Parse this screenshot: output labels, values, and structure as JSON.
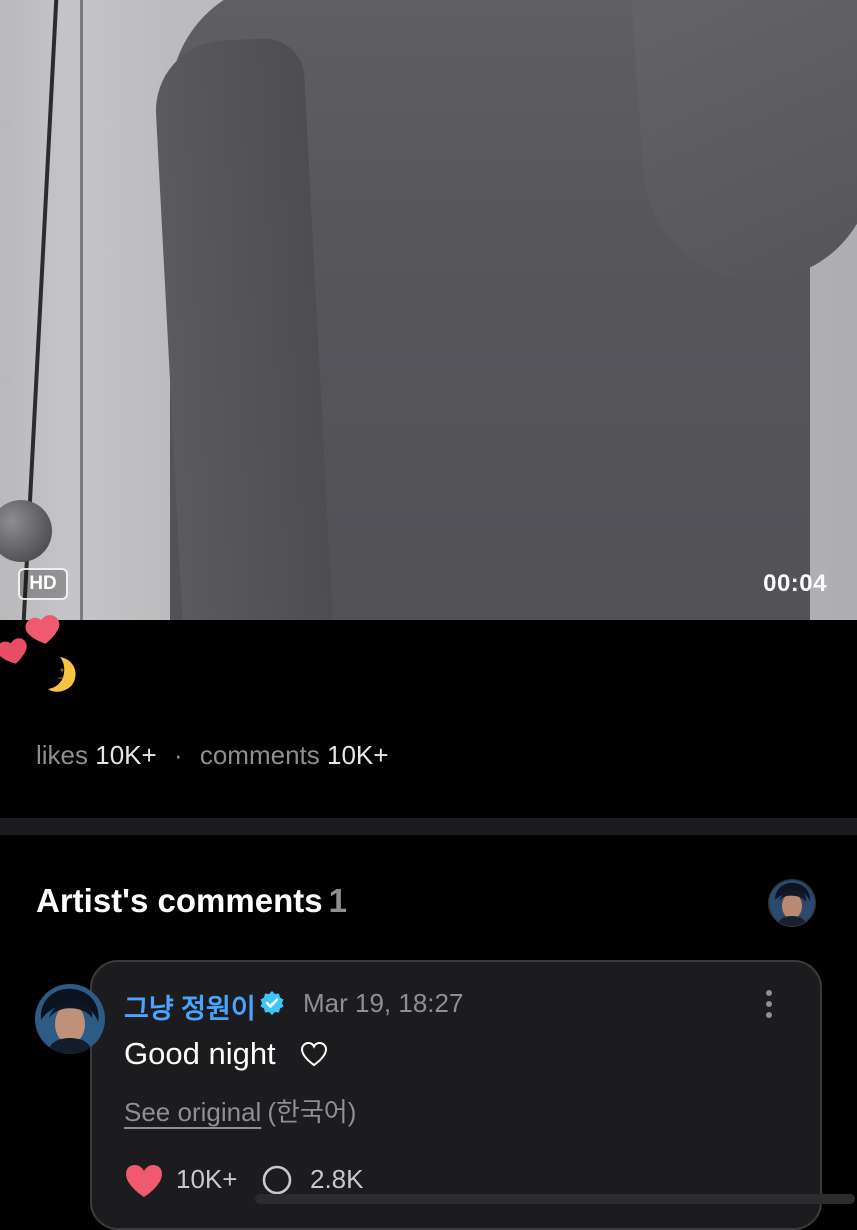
{
  "video": {
    "quality_badge": "HD",
    "duration": "00:04"
  },
  "post": {
    "emoji_icons": [
      "heart-icon",
      "heart-icon",
      "crescent-moon-icon"
    ],
    "likes_label": "likes",
    "likes_value": "10K+",
    "separator": "·",
    "comments_label": "comments",
    "comments_value": "10K+"
  },
  "artist_comments": {
    "title": "Artist's comments",
    "count": "1"
  },
  "comment": {
    "author": "그냥 정원이",
    "date": "Mar 19, 18:27",
    "text": "Good night",
    "see_original_label": "See original",
    "original_language": "(한국어)",
    "like_count": "10K+",
    "reply_count": "2.8K"
  },
  "colors": {
    "author_blue": "#4aa3ff",
    "verified_blue": "#3ec6f5",
    "heart_pink": "#ef5a6f",
    "muted_gray": "#8e8e93"
  }
}
